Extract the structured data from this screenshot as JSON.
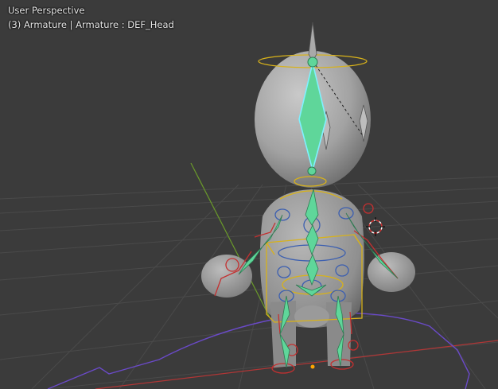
{
  "viewport": {
    "perspective_label": "User Perspective",
    "context_label": "(3) Armature | Armature : DEF_Head"
  },
  "colors": {
    "background": "#3b3b3b",
    "grid": "#4a4a4a",
    "mesh": "#9e9e9e",
    "selected_bone": "#5fd69a",
    "active_outline": "#7ff0ff",
    "control_yellow": "#d8b21a",
    "ik_red": "#c43030",
    "fk_blue": "#3c5fb0",
    "curve_purple": "#6a4ac8",
    "y_axis": "#6a9a2a",
    "x_axis": "#b03636"
  },
  "icons": [
    "3d-cursor-icon"
  ]
}
